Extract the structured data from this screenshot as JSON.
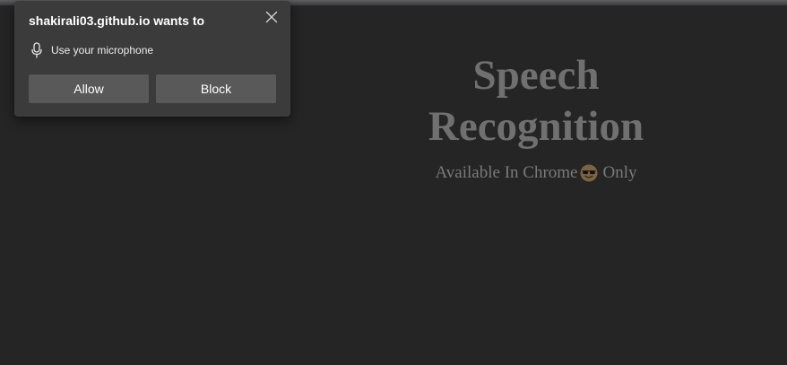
{
  "popup": {
    "title": "shakirali03.github.io wants to",
    "permission_label": "Use your microphone",
    "allow_label": "Allow",
    "block_label": "Block",
    "icons": {
      "close": "close-icon",
      "permission": "microphone-icon"
    }
  },
  "page": {
    "title_line1": "Speech",
    "title_line2": "Recognition",
    "subtitle_before": "Available In Chrome",
    "subtitle_emoji": "smiling-face-with-sunglasses-icon",
    "subtitle_after": "Only"
  },
  "colors": {
    "background": "#252525",
    "popup_background": "#3b3b3b",
    "button_background": "#595959",
    "page_text": "#707070"
  }
}
